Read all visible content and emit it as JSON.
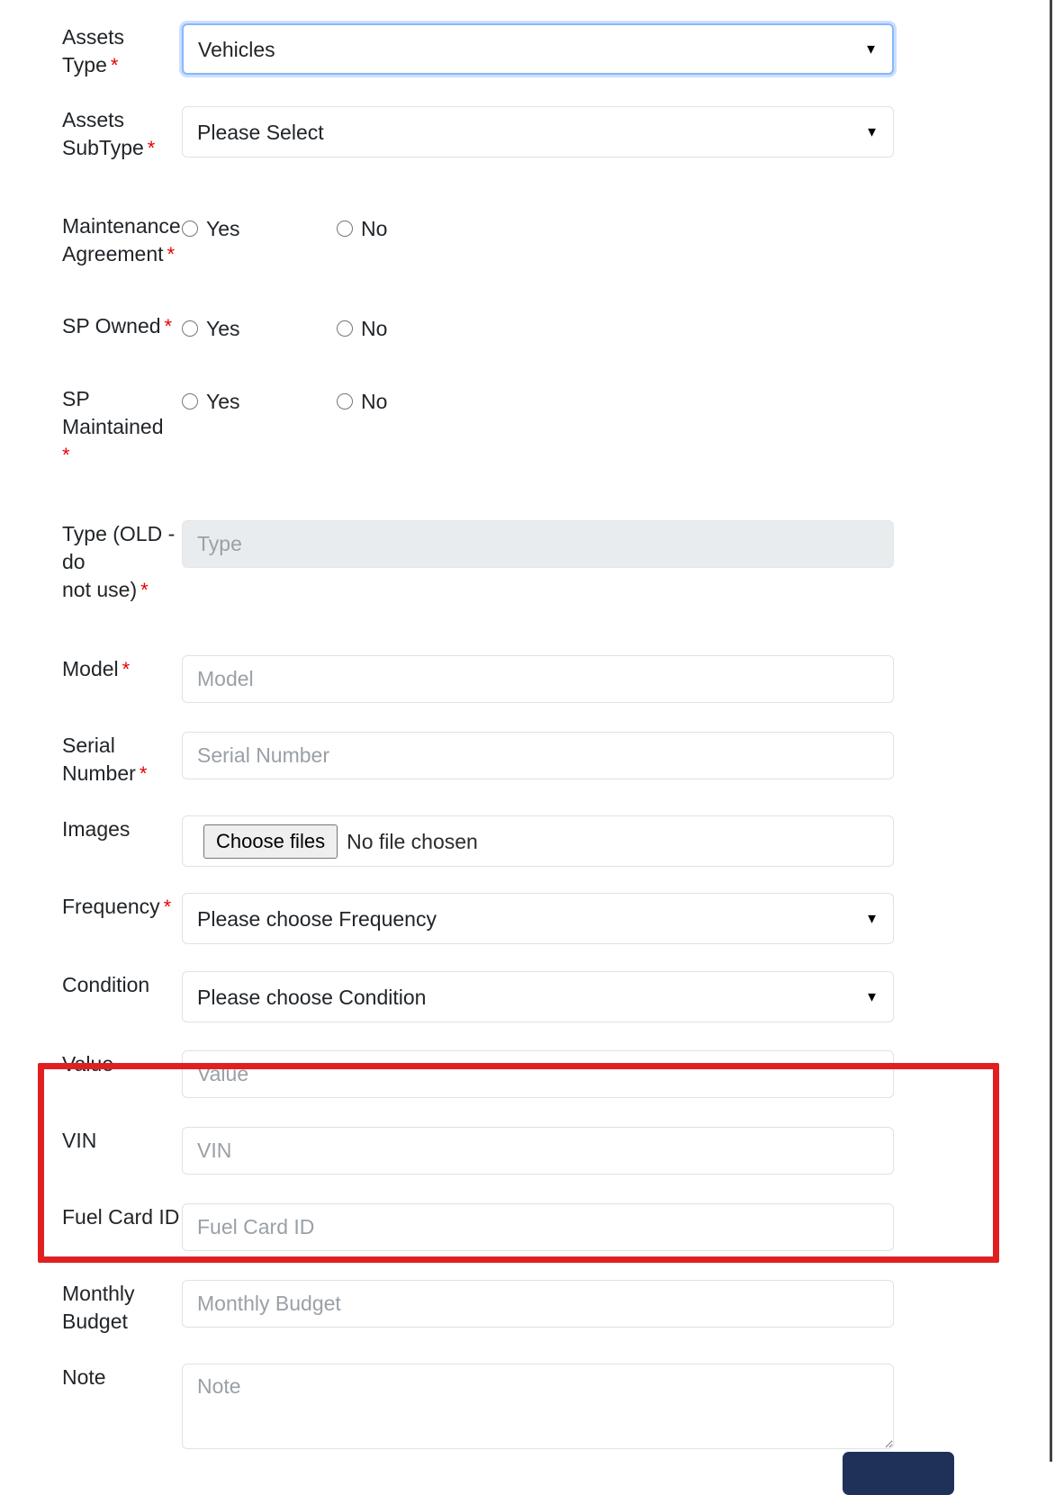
{
  "theme": {
    "required_marker_color": "#e60000",
    "annotation_box_color": "#e02020",
    "focus_border_color": "#86b7fe",
    "submit_button_color": "#1f3158",
    "disabled_field_background": "#e9ecef"
  },
  "form": {
    "assets_type": {
      "label": "Assets Type",
      "required_marker": "*",
      "value": "Vehicles",
      "caret": "▼"
    },
    "assets_subtype": {
      "label_line1": "Assets",
      "label_line2": "SubType",
      "required_marker": "*",
      "value": "Please Select",
      "caret": "▼"
    },
    "maintenance_agreement": {
      "label_line1": "Maintenance",
      "label_line2": "Agreement",
      "required_marker": "*",
      "option_yes": "Yes",
      "option_no": "No"
    },
    "sp_owned": {
      "label": "SP Owned",
      "required_marker": "*",
      "option_yes": "Yes",
      "option_no": "No"
    },
    "sp_maintained": {
      "label_line1": "SP Maintained",
      "required_marker": "*",
      "option_yes": "Yes",
      "option_no": "No"
    },
    "type_old": {
      "label_line1": "Type (OLD - do",
      "label_line2": "not use)",
      "required_marker": "*",
      "placeholder": "Type",
      "value": ""
    },
    "model": {
      "label": "Model",
      "required_marker": "*",
      "placeholder": "Model",
      "value": ""
    },
    "serial_number": {
      "label": "Serial Number",
      "required_marker": "*",
      "placeholder": "Serial Number",
      "value": ""
    },
    "images": {
      "label": "Images",
      "choose_button": "Choose files",
      "status": "No file chosen"
    },
    "frequency": {
      "label": "Frequency",
      "required_marker": "*",
      "value": "Please choose Frequency",
      "caret": "▼"
    },
    "condition": {
      "label": "Condition",
      "value": "Please choose Condition",
      "caret": "▼"
    },
    "value_field": {
      "label": "Value",
      "placeholder": "Value",
      "value": ""
    },
    "vin": {
      "label": "VIN",
      "placeholder": "VIN",
      "value": ""
    },
    "fuel_card_id": {
      "label": "Fuel Card ID",
      "placeholder": "Fuel Card ID",
      "value": ""
    },
    "monthly_budget": {
      "label": "Monthly Budget",
      "placeholder": "Monthly Budget",
      "value": ""
    },
    "note": {
      "label": "Note",
      "placeholder": "Note",
      "value": ""
    },
    "submit": {
      "label": ""
    }
  }
}
